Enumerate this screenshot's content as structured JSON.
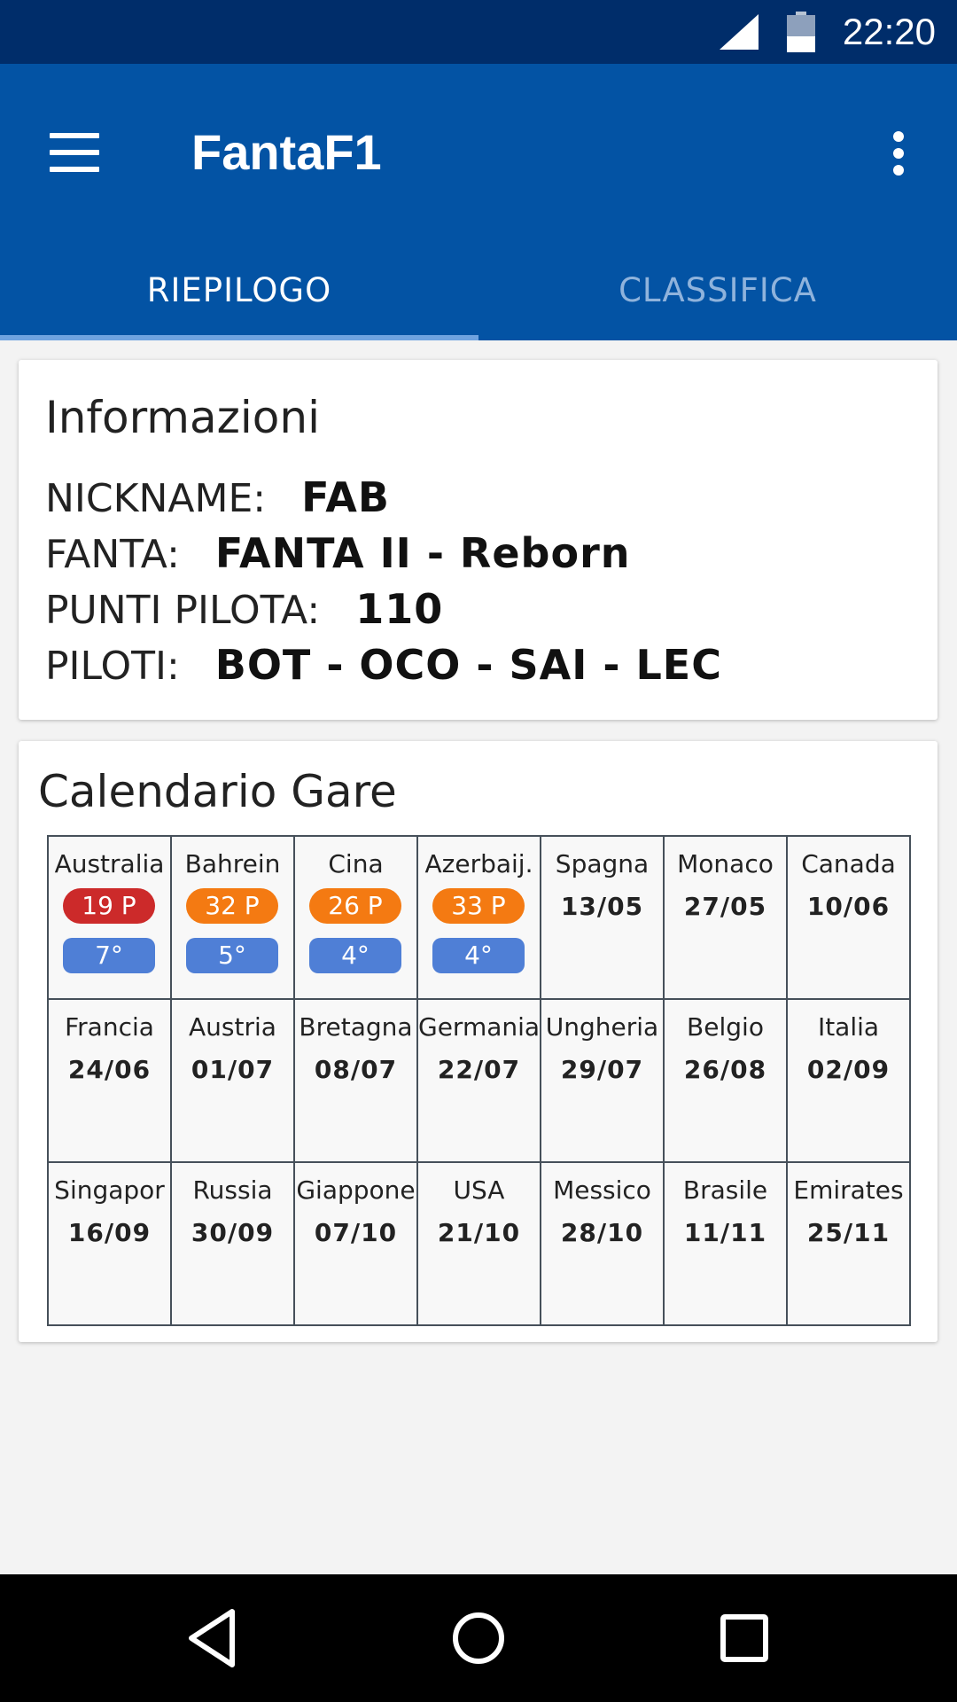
{
  "status_bar": {
    "time": "22:20"
  },
  "app_bar": {
    "title": "FantaF1"
  },
  "tabs": [
    {
      "label": "RIEPILOGO",
      "active": true
    },
    {
      "label": "CLASSIFICA",
      "active": false
    }
  ],
  "info_card": {
    "title": "Informazioni",
    "rows": [
      {
        "label": "NICKNAME:",
        "value": "FAB"
      },
      {
        "label": "FANTA:",
        "value": "FANTA II - Reborn"
      },
      {
        "label": "PUNTI PILOTA:",
        "value": "110"
      },
      {
        "label": "PILOTI:",
        "value": "BOT - OCO - SAI - LEC"
      }
    ]
  },
  "calendar_card": {
    "title": "Calendario Gare",
    "races": [
      {
        "name": "Australia",
        "points": "19 P",
        "position": "7°",
        "points_color": "#cc2a2a"
      },
      {
        "name": "Bahrein",
        "points": "32 P",
        "position": "5°",
        "points_color": "#f47a12"
      },
      {
        "name": "Cina",
        "points": "26 P",
        "position": "4°",
        "points_color": "#f47a12"
      },
      {
        "name": "Azerbaij.",
        "points": "33 P",
        "position": "4°",
        "points_color": "#f47a12"
      },
      {
        "name": "Spagna",
        "date": "13/05"
      },
      {
        "name": "Monaco",
        "date": "27/05"
      },
      {
        "name": "Canada",
        "date": "10/06"
      },
      {
        "name": "Francia",
        "date": "24/06"
      },
      {
        "name": "Austria",
        "date": "01/07"
      },
      {
        "name": "Bretagna",
        "date": "08/07"
      },
      {
        "name": "Germania",
        "date": "22/07"
      },
      {
        "name": "Ungheria",
        "date": "29/07"
      },
      {
        "name": "Belgio",
        "date": "26/08"
      },
      {
        "name": "Italia",
        "date": "02/09"
      },
      {
        "name": "Singapor",
        "date": "16/09"
      },
      {
        "name": "Russia",
        "date": "30/09"
      },
      {
        "name": "Giappone",
        "date": "07/10"
      },
      {
        "name": "USA",
        "date": "21/10"
      },
      {
        "name": "Messico",
        "date": "28/10"
      },
      {
        "name": "Brasile",
        "date": "11/11"
      },
      {
        "name": "Emirates",
        "date": "25/11"
      }
    ]
  },
  "colors": {
    "status_bar": "#002d6a",
    "app_bar": "#0353a4",
    "position_badge": "#4f7fd6"
  },
  "icons": {
    "menu": "hamburger-menu-icon",
    "overflow": "more-vert-icon",
    "back": "nav-back-triangle-icon",
    "home": "nav-home-circle-icon",
    "recents": "nav-recents-square-icon"
  }
}
